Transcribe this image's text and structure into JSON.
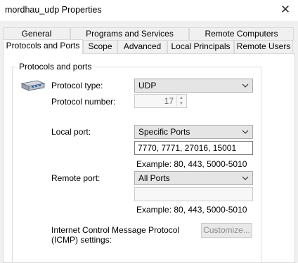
{
  "window": {
    "title": "mordhau_udp Properties",
    "close_glyph": "✕"
  },
  "tabs": {
    "row1": [
      "General",
      "Programs and Services",
      "Remote Computers"
    ],
    "row2": [
      "Protocols and Ports",
      "Scope",
      "Advanced",
      "Local Principals",
      "Remote Users"
    ],
    "selected": "Protocols and Ports"
  },
  "group": {
    "title": "Protocols and ports"
  },
  "protocol": {
    "icon": "network-cable-icon",
    "type_label": "Protocol type:",
    "type_value": "UDP",
    "number_label": "Protocol number:",
    "number_value": "17"
  },
  "local_port": {
    "label": "Local port:",
    "mode": "Specific Ports",
    "value": "7770, 7771, 27016, 15001",
    "example": "Example: 80, 443, 5000-5010"
  },
  "remote_port": {
    "label": "Remote port:",
    "mode": "All Ports",
    "value": "",
    "example": "Example: 80, 443, 5000-5010"
  },
  "icmp": {
    "label_line1": "Internet Control Message Protocol",
    "label_line2": "(ICMP) settings:",
    "button": "Customize..."
  }
}
